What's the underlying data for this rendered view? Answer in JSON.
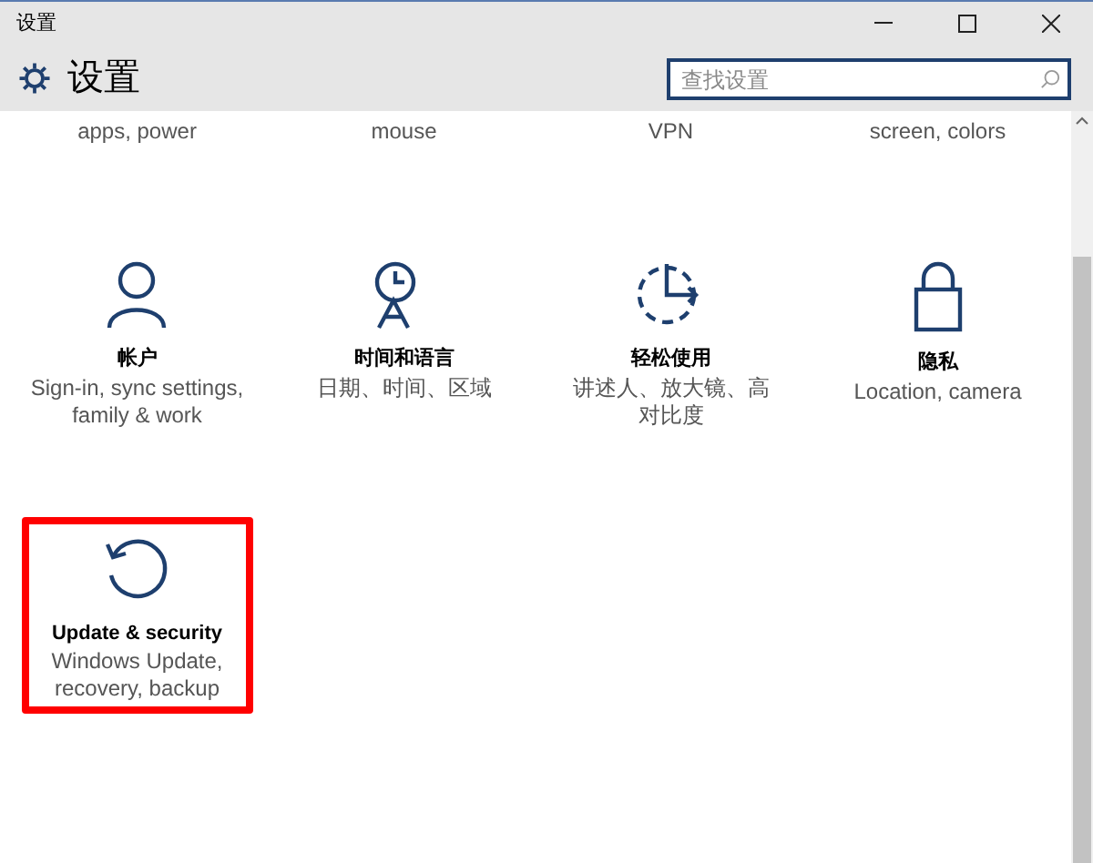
{
  "window": {
    "title": "设置"
  },
  "header": {
    "title": "设置",
    "search": {
      "placeholder": "查找设置"
    }
  },
  "partial_row": [
    "apps, power",
    "mouse",
    "VPN",
    "screen, colors"
  ],
  "items": [
    {
      "title": "帐户",
      "description": "Sign-in, sync settings, family & work",
      "highlighted": false
    },
    {
      "title": "时间和语言",
      "description": "日期、时间、区域",
      "highlighted": false
    },
    {
      "title": "轻松使用",
      "description": "讲述人、放大镜、高对比度",
      "highlighted": false
    },
    {
      "title": "隐私",
      "description": "Location, camera",
      "highlighted": false
    },
    {
      "title": "Update & security",
      "description": "Windows Update, recovery, backup",
      "highlighted": true
    }
  ]
}
